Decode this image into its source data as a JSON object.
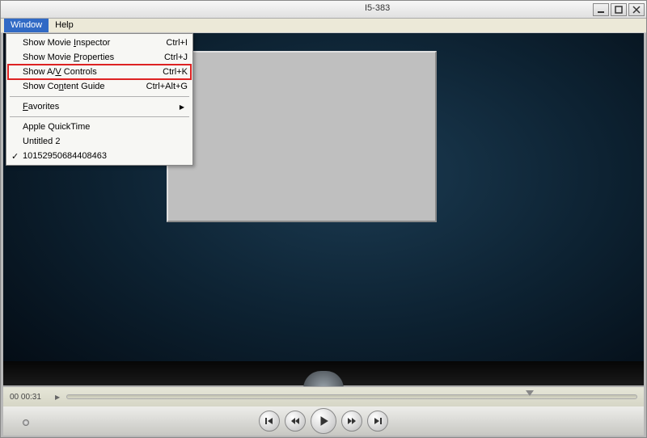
{
  "title": "I5-383",
  "menubar": {
    "window": "Window",
    "help": "Help"
  },
  "menu": {
    "showMovieInspector": {
      "label_pre": "Show Movie ",
      "label_u": "I",
      "label_post": "nspector",
      "shortcut": "Ctrl+I"
    },
    "showMovieProperties": {
      "label_pre": "Show Movie  ",
      "label_u": "P",
      "label_post": "roperties",
      "shortcut": "Ctrl+J"
    },
    "showAVControls": {
      "label_pre": "Show A/",
      "label_u": "V",
      "label_post": " Controls",
      "shortcut": "Ctrl+K"
    },
    "showContentGuide": {
      "label_pre": "Show Co",
      "label_u": "n",
      "label_post": "tent Guide",
      "shortcut": "Ctrl+Alt+G"
    },
    "favorites": {
      "label_u": "F",
      "label_post": "avorites"
    },
    "appleQuickTime": "Apple QuickTime",
    "untitled": "Untitled 2",
    "numeric": "10152950684408463"
  },
  "checkmark": "✓",
  "arrow": "▶",
  "playback": {
    "time": "00 00:31"
  },
  "icons": {
    "minimize": "minimize",
    "maximize": "maximize",
    "close": "close",
    "skipStart": "skip-start",
    "rewind": "rewind",
    "play": "play",
    "forward": "forward",
    "skipEnd": "skip-end"
  }
}
